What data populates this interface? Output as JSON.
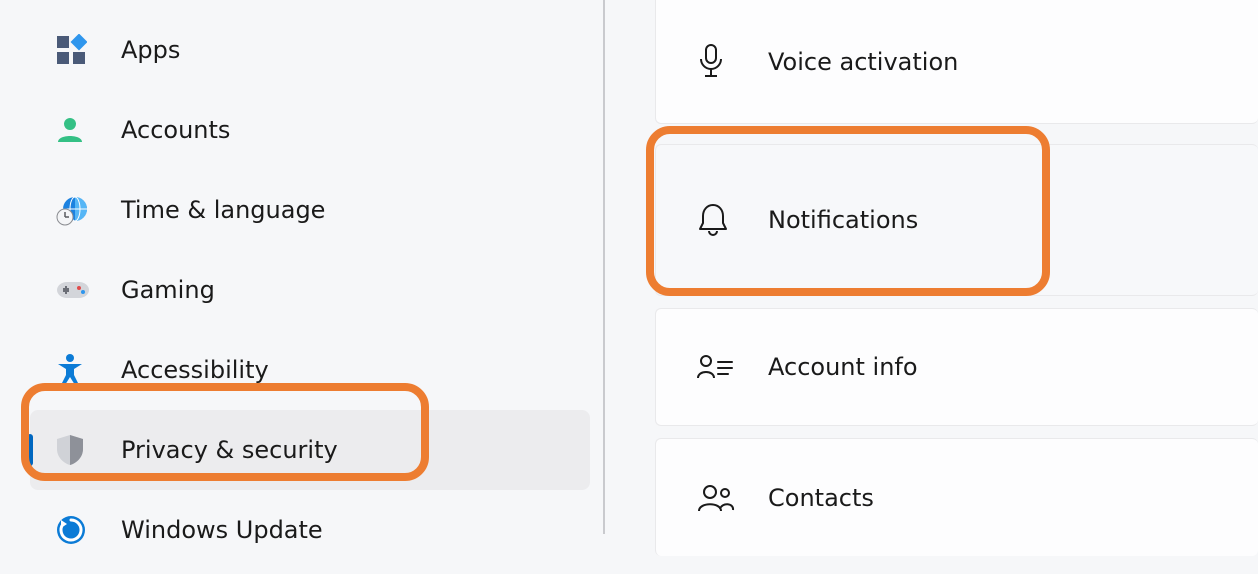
{
  "sidebar": {
    "items": [
      {
        "id": "apps",
        "label": "Apps",
        "icon": "apps-icon"
      },
      {
        "id": "accounts",
        "label": "Accounts",
        "icon": "accounts-icon"
      },
      {
        "id": "time",
        "label": "Time & language",
        "icon": "time-language-icon"
      },
      {
        "id": "gaming",
        "label": "Gaming",
        "icon": "gaming-icon"
      },
      {
        "id": "a11y",
        "label": "Accessibility",
        "icon": "accessibility-icon"
      },
      {
        "id": "privacy",
        "label": "Privacy & security",
        "icon": "shield-icon",
        "selected": true
      },
      {
        "id": "update",
        "label": "Windows Update",
        "icon": "update-icon"
      }
    ]
  },
  "main": {
    "items": [
      {
        "id": "voice",
        "label": "Voice activation",
        "icon": "microphone-icon"
      },
      {
        "id": "notif",
        "label": "Notifications",
        "icon": "bell-icon",
        "highlighted": true
      },
      {
        "id": "account",
        "label": "Account info",
        "icon": "account-info-icon"
      },
      {
        "id": "contacts",
        "label": "Contacts",
        "icon": "contacts-icon"
      }
    ]
  },
  "highlights": {
    "sidebar_item": "privacy",
    "main_item": "notif",
    "color": "#ed7d31"
  }
}
